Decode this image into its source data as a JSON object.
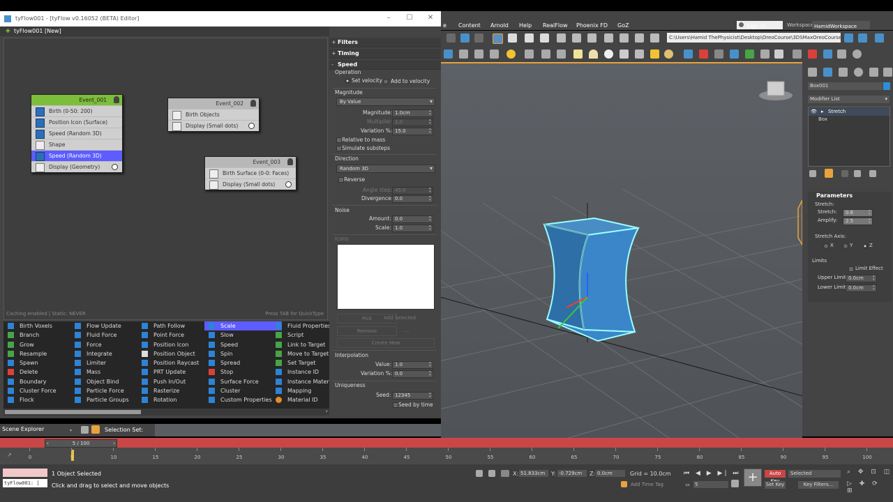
{
  "tyflow": {
    "title": "tyFlow001 - [tyFlow v0.16052 (BETA) Editor]",
    "tabs": [
      "tyFlow001",
      "[New]"
    ],
    "canvas_status": "Caching enabled | Static: NEVER",
    "canvas_hint": "Press TAB for QuickType",
    "events": [
      {
        "name": "Event_001",
        "ops": [
          "Birth (0-50: 200)",
          "Position Icon (Surface)",
          "Speed (Random 3D)",
          "Shape",
          "Speed (Random 3D)",
          "Display (Geometry)"
        ]
      },
      {
        "name": "Event_002",
        "ops": [
          "Birth Objects",
          "Display (Small dots)"
        ]
      },
      {
        "name": "Event_003",
        "ops": [
          "Birth Surface (0-0: Faces)",
          "Display (Small dots)"
        ]
      }
    ],
    "palette": [
      [
        "Birth Voxels",
        "Branch",
        "Grow",
        "Resample",
        "Spawn",
        "Delete",
        "Boundary",
        "Cluster Force",
        "Flock"
      ],
      [
        "Flow Update",
        "Fluid Force",
        "Force",
        "Integrate",
        "Limiter",
        "Mass",
        "Object Bind",
        "Particle Force",
        "Particle Groups"
      ],
      [
        "Path Follow",
        "Point Force",
        "Position Icon",
        "Position Object",
        "Position Raycast",
        "PRT Update",
        "Push In/Out",
        "Rasterize",
        "Rotation"
      ],
      [
        "Scale",
        "Slow",
        "Speed",
        "Spin",
        "Spread",
        "Stop",
        "Surface Force",
        "Cluster",
        "Custom Properties"
      ],
      [
        "Fluid Properties",
        "Script",
        "Link to Target",
        "Move to Target",
        "Set Target",
        "Instance ID",
        "Instance Materi",
        "Mapping",
        "Material ID"
      ]
    ]
  },
  "rollout": {
    "headers": [
      "Filters",
      "Timing",
      "Speed"
    ],
    "operation_label": "Operation",
    "set_velocity": "Set velocity",
    "add_to_velocity": "Add to velocity",
    "magnitude_label": "Magnitude",
    "magnitude_mode": "By Value",
    "magnitude_field_label": "Magnitude:",
    "magnitude_value": "1.0cm",
    "multiplier_label": "Multiplier:",
    "multiplier_value": "1.0",
    "variation_label": "Variation %:",
    "variation_value": "15.0",
    "relative_to_mass": "Relative to mass",
    "simulate_substeps": "Simulate substeps",
    "direction_label": "Direction",
    "direction_mode": "Random 3D",
    "reverse": "Reverse",
    "angle_step_label": "Angle step:",
    "angle_step_value": "45.0",
    "divergence_label": "Divergence:",
    "divergence_value": "0.0",
    "noise_label": "Noise",
    "amount_label": "Amount:",
    "amount_value": "0.0",
    "scale_label": "Scale:",
    "scale_value": "1.0",
    "icons_label": "Icons",
    "pick": "Pick",
    "add_selected": "Add Selected",
    "remove": "Remove",
    "ellipsis": "...",
    "create_new": "Create New",
    "interpolation_label": "Interpolation",
    "value_label": "Value:",
    "value_value": "1.0",
    "interp_variation_label": "Variation %:",
    "interp_variation_value": "0.0",
    "uniqueness_label": "Uniqueness",
    "seed_label": "Seed:",
    "seed_value": "12345",
    "seed_by_time": "Seed by time"
  },
  "max": {
    "menu": [
      "Content",
      "Arnold",
      "Help",
      "RealFlow",
      "Phoenix FD",
      "GoZ"
    ],
    "sign_in": "Sign In",
    "workspaces_label": "Workspaces:",
    "workspace": "HamidWorkspace",
    "path": "C:\\Users\\Hamid ThePhysicist\\Desktop\\OreoCourse\\3DSMaxOreoCourse",
    "cmd": {
      "object_name": "Box001",
      "modifier_list": "Modifier List",
      "stack": [
        "Stretch",
        "Box"
      ],
      "parameters": "Parameters",
      "stretch_group": "Stretch:",
      "stretch_label": "Stretch:",
      "stretch_value": "0.6",
      "amplify_label": "Amplify:",
      "amplify_value": "2.5",
      "axis_label": "Stretch Axis:",
      "axis_x": "X",
      "axis_y": "Y",
      "axis_z": "Z",
      "limits_label": "Limits",
      "limit_effect": "Limit Effect",
      "upper_label": "Upper Limit:",
      "upper_value": "0.0cm",
      "lower_label": "Lower Limit:",
      "lower_value": "0.0cm"
    },
    "scene_explorer": "Scene Explorer",
    "selection_set": "Selection Set:",
    "frame": "5 / 100",
    "ticks": [
      "0",
      "5",
      "10",
      "15",
      "20",
      "25",
      "30",
      "35",
      "40",
      "45",
      "50",
      "55",
      "60",
      "65",
      "70",
      "75",
      "80",
      "85",
      "90",
      "95",
      "100"
    ],
    "status_listener": "tyFlow001: [",
    "status_selected": "1 Object Selected",
    "status_prompt": "Click and drag to select and move objects",
    "coord_x_label": "X:",
    "coord_x": "51.833cm",
    "coord_y_label": "Y:",
    "coord_y": "-0.729cm",
    "coord_z_label": "Z:",
    "coord_z": "0.0cm",
    "grid": "Grid = 10.0cm",
    "add_time_tag": "Add Time Tag",
    "auto_key": "Auto Key",
    "selected": "Selected",
    "set_key": "Set Key",
    "key_filters": "Key Filters...",
    "frame_field": "5"
  },
  "colors": {
    "accent_blue": "#5c5cff",
    "event_green": "#7cbe3a",
    "timeline_red": "#c94646",
    "viewport": "#5a5e62",
    "box_blue": "#2f8fd6"
  }
}
